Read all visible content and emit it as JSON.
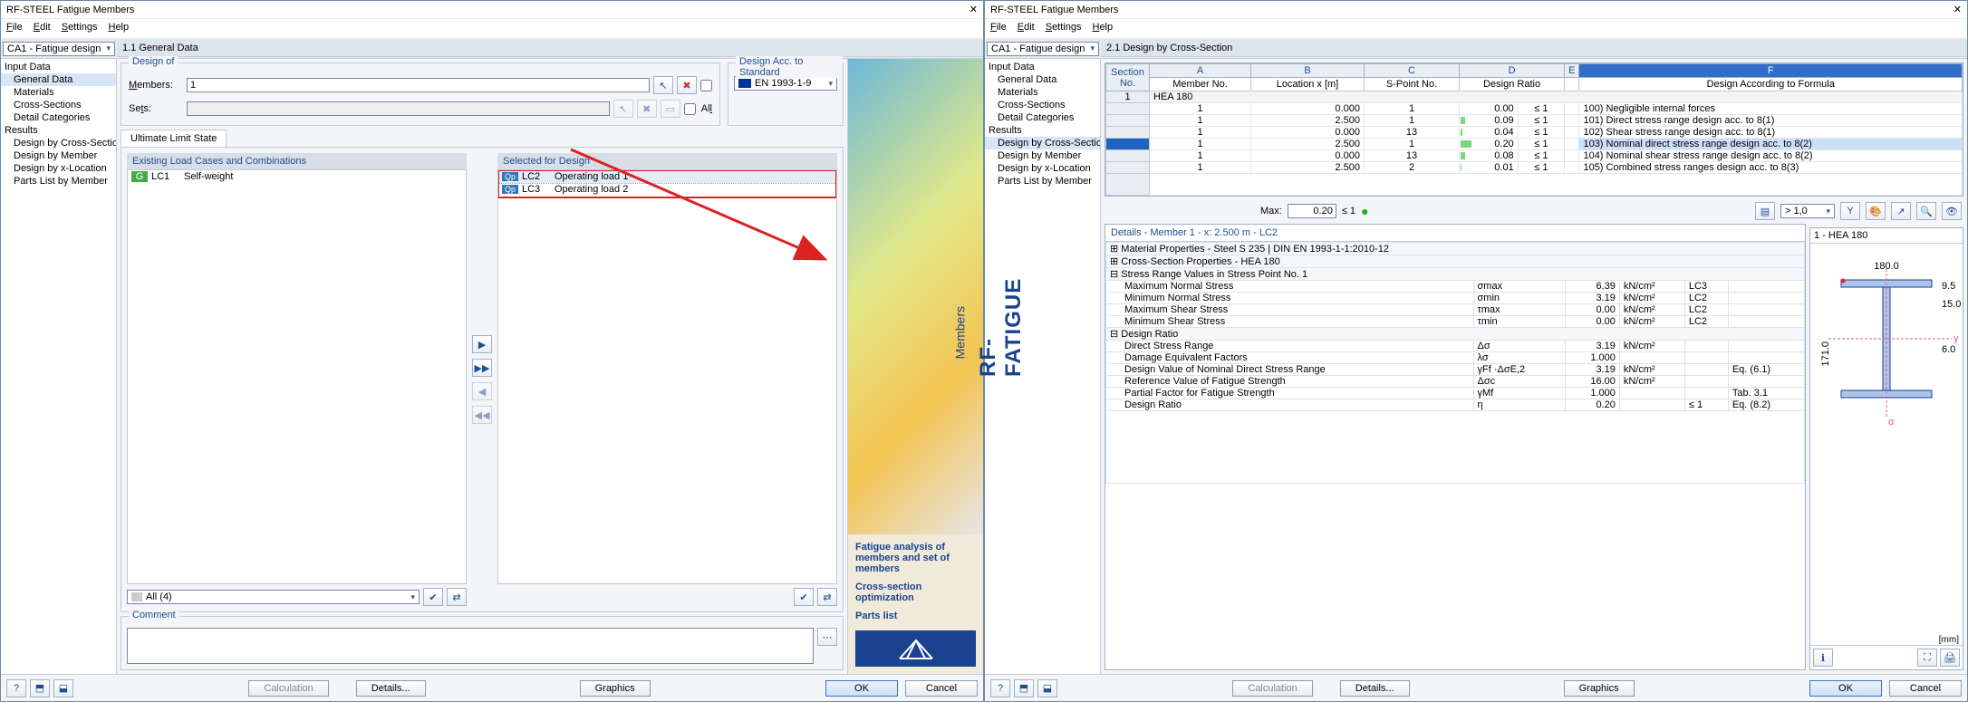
{
  "app_title": "RF-STEEL Fatigue Members",
  "menus": {
    "file": "File",
    "edit": "Edit",
    "settings": "Settings",
    "help": "Help"
  },
  "combo_case": "CA1 - Fatigue design",
  "left_win": {
    "section_title": "1.1 General Data",
    "nav": {
      "input": "Input Data",
      "general": "General Data",
      "materials": "Materials",
      "cs": "Cross-Sections",
      "detail": "Detail Categories",
      "results": "Results",
      "dcs": "Design by Cross-Section",
      "dm": "Design by Member",
      "dx": "Design by x-Location",
      "pl": "Parts List by Member"
    },
    "design_of": "Design of",
    "members_lbl": "Members:",
    "members_val": "1",
    "sets_lbl": "Sets:",
    "all_lbl": "All",
    "std_box": "Design Acc. to Standard",
    "std_val": "EN 1993-1-9",
    "tab_uls": "Ultimate Limit State",
    "existing_hdr": "Existing Load Cases and Combinations",
    "selected_hdr": "Selected for Design",
    "lc1_tag": "G",
    "lc1": "LC1",
    "lc1_name": "Self-weight",
    "lc2_tag": "Qp",
    "lc2": "LC2",
    "lc2_name": "Operating load 1",
    "lc3_tag": "Qp",
    "lc3": "LC3",
    "lc3_name": "Operating load 2",
    "filter": "All (4)",
    "comment": "Comment",
    "side": {
      "brand1": "RF-FATIGUE",
      "brand2": "Members",
      "t1": "Fatigue analysis of members and set of members",
      "t2": "Cross-section optimization",
      "t3": "Parts list"
    },
    "btn_calc": "Calculation",
    "btn_details": "Details...",
    "btn_graphics": "Graphics",
    "btn_ok": "OK",
    "btn_cancel": "Cancel"
  },
  "right_win": {
    "section_title": "2.1 Design by Cross-Section",
    "cols": {
      "A": "A",
      "B": "B",
      "C": "C",
      "D": "D",
      "E": "E",
      "F": "F",
      "sec": "Section No.",
      "mem": "Member No.",
      "loc": "Location x [m]",
      "sp": "S-Point No.",
      "ratio": "Design Ratio",
      "formula": "Design According to Formula"
    },
    "hea": "HEA 180",
    "rows": [
      {
        "m": "1",
        "x": "0.000",
        "sp": "1",
        "r": "0.00",
        "lim": "≤ 1",
        "f": "100) Negligible internal forces"
      },
      {
        "m": "1",
        "x": "2.500",
        "sp": "1",
        "r": "0.09",
        "lim": "≤ 1",
        "f": "101) Direct stress range design acc. to 8(1)"
      },
      {
        "m": "1",
        "x": "0.000",
        "sp": "13",
        "r": "0.04",
        "lim": "≤ 1",
        "f": "102) Shear stress range design acc. to 8(1)"
      },
      {
        "m": "1",
        "x": "2.500",
        "sp": "1",
        "r": "0.20",
        "lim": "≤ 1",
        "f": "103) Nominal direct stress range design acc. to 8(2)"
      },
      {
        "m": "1",
        "x": "0.000",
        "sp": "13",
        "r": "0.08",
        "lim": "≤ 1",
        "f": "104) Nominal shear stress range design acc. to 8(2)"
      },
      {
        "m": "1",
        "x": "2.500",
        "sp": "2",
        "r": "0.01",
        "lim": "≤ 1",
        "f": "105) Combined stress ranges design acc. to 8(3)"
      }
    ],
    "max_lbl": "Max:",
    "max_val": "0.20",
    "max_lim": "≤ 1",
    "spinner": "> 1,0",
    "details_title": "Details - Member 1 - x: 2.500 m - LC2",
    "d": {
      "mat": "Material Properties - Steel S 235 | DIN EN 1993-1-1:2010-12",
      "csp": "Cross-Section Properties  -  HEA 180",
      "srv": "Stress Range Values in Stress Point No. 1",
      "mns": "Maximum Normal Stress",
      "mns_sym": "σmax",
      "mns_v": "6.39",
      "mns_u": "kN/cm²",
      "mns_lc": "LC3",
      "mins": "Minimum Normal Stress",
      "mins_sym": "σmin",
      "mins_v": "3.19",
      "mins_u": "kN/cm²",
      "mins_lc": "LC2",
      "mxs": "Maximum Shear Stress",
      "mxs_sym": "τmax",
      "mxs_v": "0.00",
      "mxs_u": "kN/cm²",
      "mxs_lc": "LC2",
      "mis": "Minimum Shear Stress",
      "mis_sym": "τmin",
      "mis_v": "0.00",
      "mis_u": "kN/cm²",
      "mis_lc": "LC2",
      "dr": "Design Ratio",
      "dsr": "Direct Stress Range",
      "dsr_sym": "Δσ",
      "dsr_v": "3.19",
      "dsr_u": "kN/cm²",
      "def": "Damage Equivalent Factors",
      "def_sym": "λσ",
      "def_v": "1.000",
      "dvn": "Design Value of Nominal Direct Stress Range",
      "dvn_sym": "γFf ·ΔσE,2",
      "dvn_v": "3.19",
      "dvn_u": "kN/cm²",
      "dvn_eq": "Eq. (6.1)",
      "rvf": "Reference Value of Fatigue Strength",
      "rvf_sym": "Δσc",
      "rvf_v": "16.00",
      "rvf_u": "kN/cm²",
      "pff": "Partial Factor for Fatigue Strength",
      "pff_sym": "γMf",
      "pff_v": "1.000",
      "pff_eq": "Tab. 3.1",
      "ratio": "Design Ratio",
      "ratio_sym": "η",
      "ratio_v": "0.20",
      "ratio_lim": "≤ 1",
      "ratio_eq": "Eq. (8.2)"
    },
    "viewer_title": "1 - HEA 180",
    "dim": {
      "w": "180.0",
      "h": "171.0",
      "tf": "9.5",
      "rf": "15.0",
      "tw": "6.0",
      "ax": "y",
      "ay": "α",
      "unit": "[mm]"
    }
  }
}
